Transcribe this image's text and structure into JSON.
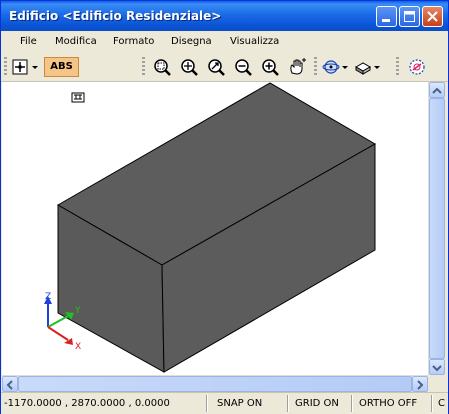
{
  "window": {
    "title": "Edificio <Edificio Residenziale>",
    "controls": [
      "minimize-icon",
      "maximize-icon",
      "close-icon"
    ]
  },
  "menu": {
    "items": [
      "File",
      "Modifica",
      "Formato",
      "Disegna",
      "Visualizza"
    ]
  },
  "toolbar": {
    "abs_label": "ABS",
    "icons": [
      "snap-point-icon",
      "zoom-window-icon",
      "zoom-realtime-icon",
      "zoom-extents-icon",
      "zoom-out-icon",
      "zoom-in-icon",
      "pan-icon",
      "orbit-view-icon",
      "shade-mode-icon",
      "render-icon"
    ]
  },
  "viewport": {
    "box_fill": "#5b5b5b",
    "axes": {
      "x": "X",
      "y": "Y",
      "z": "Z"
    },
    "axis_colors": {
      "x": "#e02020",
      "y": "#20c020",
      "z": "#2040e0"
    }
  },
  "status": {
    "coordinates": "-1170.0000 , 2870.0000 , 0.0000",
    "snap": "SNAP ON",
    "grid": "GRID ON",
    "ortho": "ORTHO OFF",
    "extra": "C"
  }
}
